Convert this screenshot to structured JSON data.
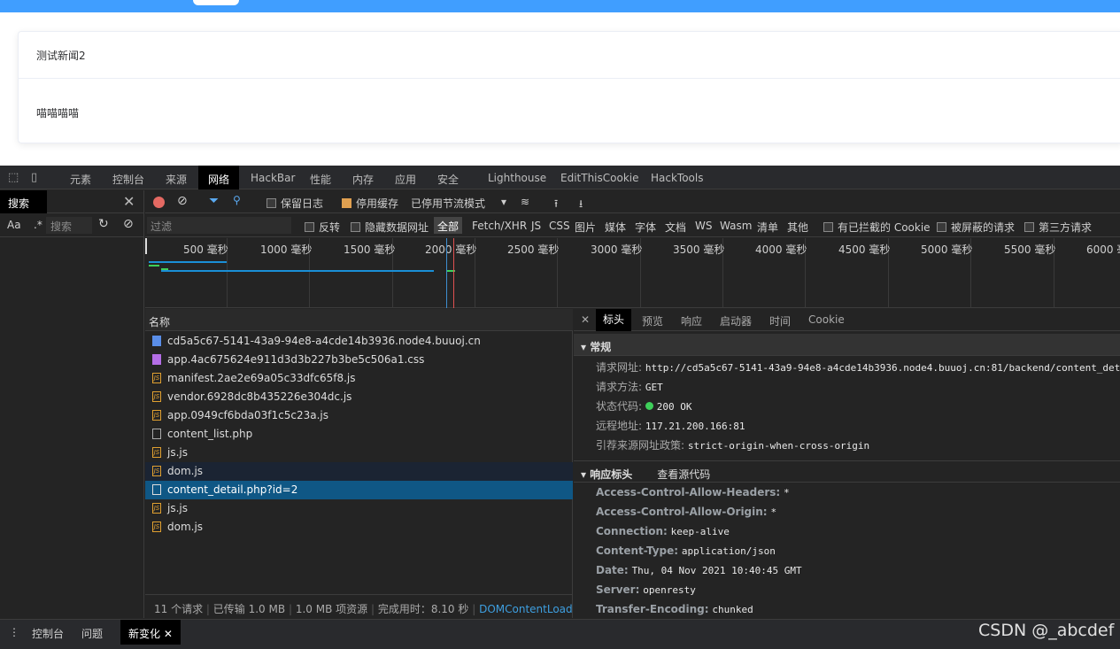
{
  "page": {
    "card_title": "测试新闻2",
    "card_body": "喵喵喵喵"
  },
  "devtools_tabs": [
    "元素",
    "控制台",
    "来源",
    "网络",
    "HackBar",
    "性能",
    "内存",
    "应用",
    "安全",
    "Lighthouse",
    "EditThisCookie",
    "HackTools"
  ],
  "search_panel": {
    "label": "搜索",
    "aa": "Aa",
    "regex": ".*",
    "placeholder": "搜索"
  },
  "toolbar1": {
    "preserve_log": "保留日志",
    "disable_cache": "停用缓存",
    "throttle": "已停用节流模式"
  },
  "toolbar2": {
    "filter_placeholder": "过滤",
    "invert": "反转",
    "hide_data_urls": "隐藏数据网址",
    "all": "全部",
    "types": [
      "Fetch/XHR",
      "JS",
      "CSS",
      "图片",
      "媒体",
      "字体",
      "文档",
      "WS",
      "Wasm",
      "清单",
      "其他"
    ],
    "blocked_cookies": "有已拦截的 Cookie",
    "blocked_requests": "被屏蔽的请求",
    "third_party": "第三方请求"
  },
  "timeline_ticks": [
    "500 毫秒",
    "1000 毫秒",
    "1500 毫秒",
    "2000 毫秒",
    "2500 毫秒",
    "3000 毫秒",
    "3500 毫秒",
    "4000 毫秒",
    "4500 毫秒",
    "5000 毫秒",
    "5500 毫秒",
    "6000 毫秒"
  ],
  "list_header": "名称",
  "requests": [
    {
      "name": "cd5a5c67-5141-43a9-94e8-a4cde14b3936.node4.buuoj.cn",
      "type": "doc"
    },
    {
      "name": "app.4ac675624e911d3d3b227b3be5c506a1.css",
      "type": "css"
    },
    {
      "name": "manifest.2ae2e69a05c33dfc65f8.js",
      "type": "js"
    },
    {
      "name": "vendor.6928dc8b435226e304dc.js",
      "type": "js"
    },
    {
      "name": "app.0949cf6bda03f1c5c23a.js",
      "type": "js"
    },
    {
      "name": "content_list.php",
      "type": "xhr"
    },
    {
      "name": "js.js",
      "type": "js"
    },
    {
      "name": "dom.js",
      "type": "js"
    },
    {
      "name": "content_detail.php?id=2",
      "type": "xhr"
    },
    {
      "name": "js.js",
      "type": "js"
    },
    {
      "name": "dom.js",
      "type": "js"
    }
  ],
  "status": {
    "requests": "11 个请求",
    "transferred": "已传输 1.0 MB",
    "resources": "1.0 MB 项资源",
    "finish": "完成用时：8.10 秒",
    "dcl": "DOMContentLoad"
  },
  "detail_tabs": [
    "标头",
    "预览",
    "响应",
    "启动器",
    "时间",
    "Cookie"
  ],
  "general": {
    "title": "常规",
    "url_k": "请求网址:",
    "url_v": "http://cd5a5c67-5141-43a9-94e8-a4cde14b3936.node4.buuoj.cn:81/backend/content_det",
    "method_k": "请求方法:",
    "method_v": "GET",
    "status_k": "状态代码:",
    "status_v": "200 OK",
    "remote_k": "远程地址:",
    "remote_v": "117.21.200.166:81",
    "ref_k": "引荐来源网址政策:",
    "ref_v": "strict-origin-when-cross-origin"
  },
  "resp": {
    "title": "响应标头",
    "view_source": "查看源代码",
    "headers": [
      {
        "k": "Access-Control-Allow-Headers:",
        "v": "*"
      },
      {
        "k": "Access-Control-Allow-Origin:",
        "v": "*"
      },
      {
        "k": "Connection:",
        "v": "keep-alive"
      },
      {
        "k": "Content-Type:",
        "v": "application/json"
      },
      {
        "k": "Date:",
        "v": "Thu, 04 Nov 2021 10:40:45 GMT"
      },
      {
        "k": "Server:",
        "v": "openresty"
      },
      {
        "k": "Transfer-Encoding:",
        "v": "chunked"
      }
    ]
  },
  "drawer": {
    "console": "控制台",
    "issues": "问题",
    "changes": "新变化"
  },
  "watermark": "CSDN @_abcdef"
}
